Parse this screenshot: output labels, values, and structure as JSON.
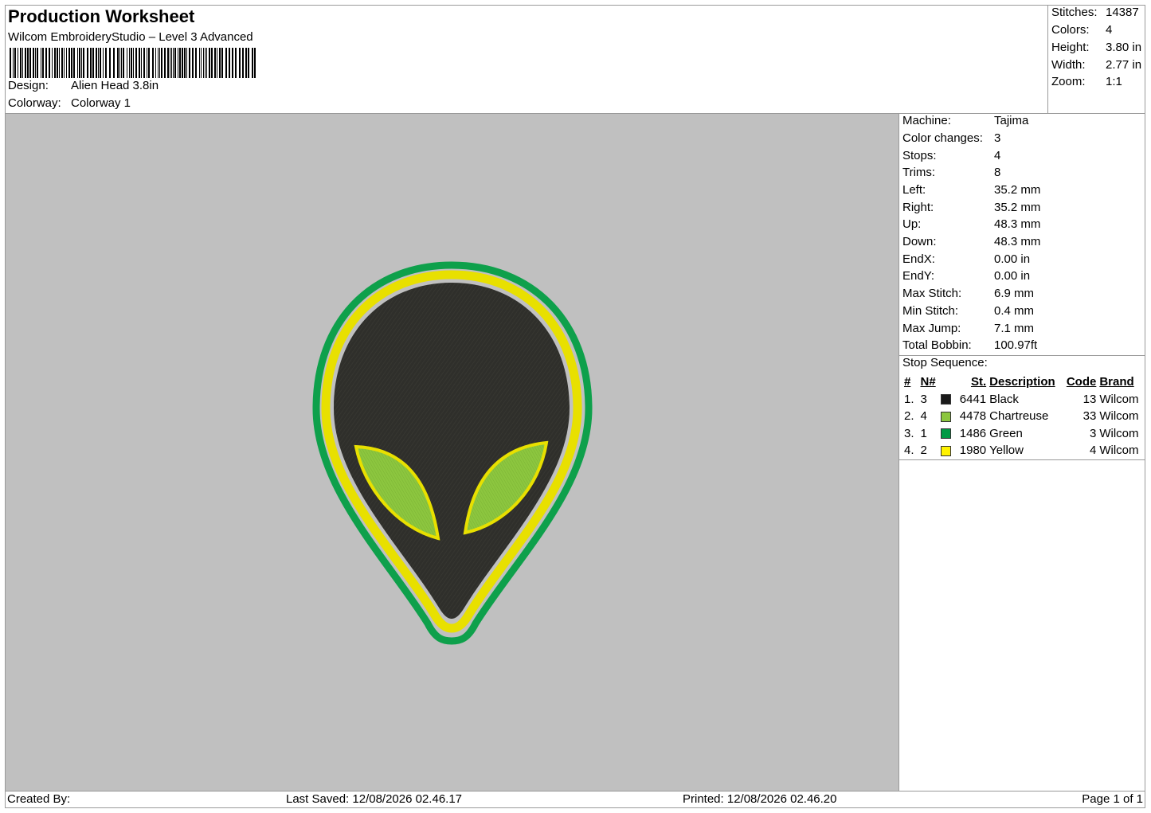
{
  "header": {
    "title": "Production Worksheet",
    "software": "Wilcom EmbroideryStudio – Level 3 Advanced",
    "design_label": "Design:",
    "design_value": "Alien Head 3.8in",
    "colorway_label": "Colorway:",
    "colorway_value": "Colorway 1"
  },
  "summary": [
    {
      "label": "Stitches:",
      "value": "14387"
    },
    {
      "label": "Colors:",
      "value": "4"
    },
    {
      "label": "Height:",
      "value": "3.80 in"
    },
    {
      "label": "Width:",
      "value": "2.77 in"
    },
    {
      "label": "Zoom:",
      "value": "1:1"
    }
  ],
  "machine": [
    {
      "label": "Machine:",
      "value": "Tajima"
    },
    {
      "label": "Color changes:",
      "value": "3"
    },
    {
      "label": "Stops:",
      "value": "4"
    },
    {
      "label": "Trims:",
      "value": "8"
    },
    {
      "label": "Left:",
      "value": "35.2 mm"
    },
    {
      "label": "Right:",
      "value": "35.2 mm"
    },
    {
      "label": "Up:",
      "value": "48.3 mm"
    },
    {
      "label": "Down:",
      "value": "48.3 mm"
    },
    {
      "label": "EndX:",
      "value": "0.00 in"
    },
    {
      "label": "EndY:",
      "value": "0.00 in"
    },
    {
      "label": "Max Stitch:",
      "value": "6.9 mm"
    },
    {
      "label": "Min Stitch:",
      "value": "0.4 mm"
    },
    {
      "label": "Max Jump:",
      "value": "7.1 mm"
    },
    {
      "label": "Total Bobbin:",
      "value": "100.97ft"
    }
  ],
  "stop_sequence": {
    "heading": "Stop Sequence:",
    "columns": {
      "idx": "#",
      "n": "N#",
      "st": "St.",
      "desc": "Description",
      "code": "Code",
      "brand": "Brand"
    },
    "rows": [
      {
        "idx": "1.",
        "n": "3",
        "color": "#1a1a1a",
        "st": "6441",
        "desc": "Black",
        "code": "13",
        "brand": "Wilcom"
      },
      {
        "idx": "2.",
        "n": "4",
        "color": "#8cc63f",
        "st": "4478",
        "desc": "Chartreuse",
        "code": "33",
        "brand": "Wilcom"
      },
      {
        "idx": "3.",
        "n": "1",
        "color": "#009a44",
        "st": "1486",
        "desc": "Green",
        "code": "3",
        "brand": "Wilcom"
      },
      {
        "idx": "4.",
        "n": "2",
        "color": "#fff200",
        "st": "1980",
        "desc": "Yellow",
        "code": "4",
        "brand": "Wilcom"
      }
    ]
  },
  "footer": {
    "created_by": "Created By:",
    "last_saved": "Last Saved: 12/08/2026 02.46.17",
    "printed": "Printed: 12/08/2026 02.46.20",
    "page": "Page 1 of 1"
  },
  "design_colors": {
    "background": "#c0c0c0",
    "outer_border": "#0ea04b",
    "inner_border": "#e8e000",
    "fill": "#2f2f2b",
    "eye_fill": "#8cc63f"
  }
}
